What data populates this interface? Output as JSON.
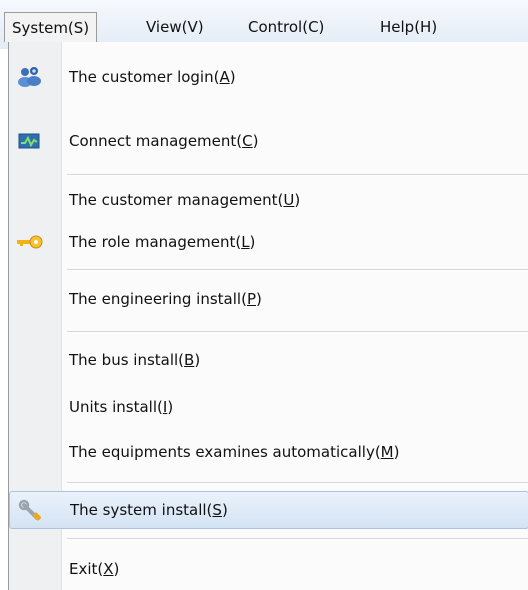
{
  "menubar": {
    "items": [
      "System(S)",
      "View(V)",
      "Control(C)",
      "Help(H)"
    ]
  },
  "menu": {
    "items": [
      {
        "text": "The customer login(",
        "key": "A",
        "close": ")",
        "icon": "customer-login-icon"
      },
      {
        "text": "Connect management(",
        "key": "C",
        "close": ")",
        "icon": "connect-management-icon"
      },
      {
        "text": "The customer management(",
        "key": "U",
        "close": ")"
      },
      {
        "text": "The role management(",
        "key": "L",
        "close": ")",
        "icon": "key-icon"
      },
      {
        "text": "The engineering install(",
        "key": "P",
        "close": ")"
      },
      {
        "text": "The bus install(",
        "key": "B",
        "close": ")"
      },
      {
        "text": "Units install(",
        "key": "I",
        "close": ")"
      },
      {
        "text": "The equipments examines automatically(",
        "key": "M",
        "close": ")"
      },
      {
        "text": "The system install(",
        "key": "S",
        "close": ")",
        "icon": "wrench-icon",
        "highlighted": true
      },
      {
        "text": "Exit(",
        "key": "X",
        "close": ")"
      }
    ]
  },
  "colors": {
    "highlight": "#d4e3f4",
    "icon_column": "#eef0f1",
    "menubar": "#e3ebf5"
  }
}
